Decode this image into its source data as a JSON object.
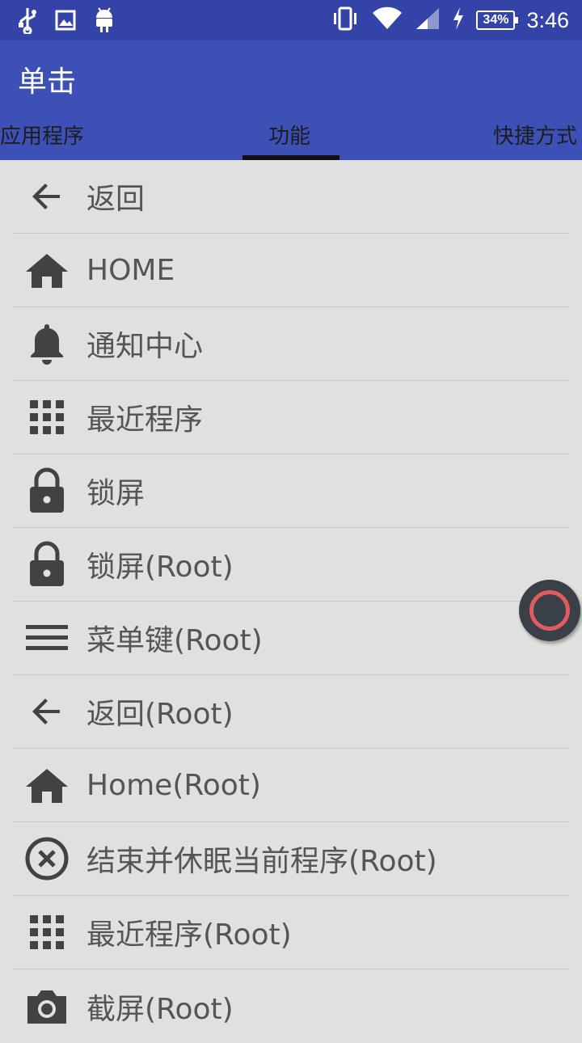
{
  "status_bar": {
    "time": "3:46",
    "battery": "34%",
    "icons_left": [
      "usb-icon",
      "image-icon",
      "android-icon"
    ],
    "icons_right": [
      "vibrate-icon",
      "wifi-icon",
      "signal-icon",
      "charging-icon"
    ]
  },
  "app_bar": {
    "title": "单击",
    "tabs": [
      "应用程序",
      "功能",
      "快捷方式"
    ],
    "selected_tab": "功能",
    "background": "#3d50b5"
  },
  "list": {
    "items": [
      {
        "label": "返回",
        "icon": "arrow-back-icon"
      },
      {
        "label": "HOME",
        "icon": "home-icon"
      },
      {
        "label": "通知中心",
        "icon": "bell-icon"
      },
      {
        "label": "最近程序",
        "icon": "grid-icon"
      },
      {
        "label": "锁屏",
        "icon": "lock-icon"
      },
      {
        "label": "锁屏(Root)",
        "icon": "lock-icon"
      },
      {
        "label": "菜单键(Root)",
        "icon": "menu-icon"
      },
      {
        "label": "返回(Root)",
        "icon": "arrow-back-icon"
      },
      {
        "label": "Home(Root)",
        "icon": "home-icon"
      },
      {
        "label": "结束并休眠当前程序(Root)",
        "icon": "close-circle-icon"
      },
      {
        "label": "最近程序(Root)",
        "icon": "grid-icon"
      },
      {
        "label": "截屏(Root)",
        "icon": "camera-icon"
      }
    ]
  },
  "floating_button": {
    "icon": "circle-ring-icon",
    "accent": "#e05c62"
  }
}
